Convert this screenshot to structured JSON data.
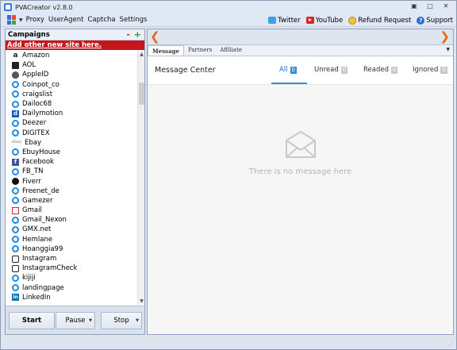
{
  "window": {
    "title": "PVACreator v2.8.0",
    "minimize": "▣",
    "maximize": "□",
    "close": "✕"
  },
  "menu": {
    "items": [
      "Proxy",
      "UserAgent",
      "Captcha",
      "Settings"
    ],
    "links": [
      {
        "label": "Twitter",
        "icon": "twitter-icon"
      },
      {
        "label": "YouTube",
        "icon": "youtube-icon"
      },
      {
        "label": "Refund Request",
        "icon": "refund-icon"
      },
      {
        "label": "Support",
        "icon": "support-icon"
      }
    ]
  },
  "campaigns": {
    "title": "Campaigns",
    "remove": "-",
    "add": "+",
    "add_site": "Add other new site here.",
    "sites": [
      {
        "label": "Amazon",
        "icon": "amz"
      },
      {
        "label": "AOL",
        "icon": "aol"
      },
      {
        "label": "AppleID",
        "icon": "apple"
      },
      {
        "label": "Coinpot_co",
        "icon": "ie"
      },
      {
        "label": "craigslist",
        "icon": "ie"
      },
      {
        "label": "Dailoc68",
        "icon": "ie"
      },
      {
        "label": "Dailymotion",
        "icon": "dm"
      },
      {
        "label": "Deezer",
        "icon": "ie"
      },
      {
        "label": "DIGITEX",
        "icon": "ie"
      },
      {
        "label": "Ebay",
        "icon": "ebay"
      },
      {
        "label": "EbuyHouse",
        "icon": "ie"
      },
      {
        "label": "Facebook",
        "icon": "fb"
      },
      {
        "label": "FB_TN",
        "icon": "ie"
      },
      {
        "label": "Fiverr",
        "icon": "fiverr"
      },
      {
        "label": "Freenet_de",
        "icon": "ie"
      },
      {
        "label": "Gamezer",
        "icon": "ie"
      },
      {
        "label": "Gmail",
        "icon": "gmail"
      },
      {
        "label": "Gmail_Nexon",
        "icon": "ie"
      },
      {
        "label": "GMX.net",
        "icon": "ie"
      },
      {
        "label": "Hemlane",
        "icon": "ie"
      },
      {
        "label": "Hoanggia99",
        "icon": "ie"
      },
      {
        "label": "Instagram",
        "icon": "insta"
      },
      {
        "label": "InstagramCheck",
        "icon": "insta"
      },
      {
        "label": "kijiji",
        "icon": "ie"
      },
      {
        "label": "landingpage",
        "icon": "ie"
      },
      {
        "label": "LinkedIn",
        "icon": "in"
      }
    ]
  },
  "buttons": {
    "start": "Start",
    "pause": "Pause",
    "stop": "Stop",
    "dropdown": "▼"
  },
  "nav": {
    "back": "❮",
    "forward": "❯"
  },
  "tabs": {
    "items": [
      "Message",
      "Partners",
      "Affiliate"
    ],
    "dropdown": "▼"
  },
  "messages": {
    "title": "Message Center",
    "filters": [
      {
        "label": "All",
        "count": "0"
      },
      {
        "label": "Unread",
        "count": "0"
      },
      {
        "label": "Readed",
        "count": "0"
      },
      {
        "label": "Ignored",
        "count": "0"
      }
    ],
    "empty": "There is no message here"
  },
  "colors": {
    "accent": "#2f8fd8",
    "add_site_bg": "#c4161c",
    "arrow": "#e06a1c"
  }
}
